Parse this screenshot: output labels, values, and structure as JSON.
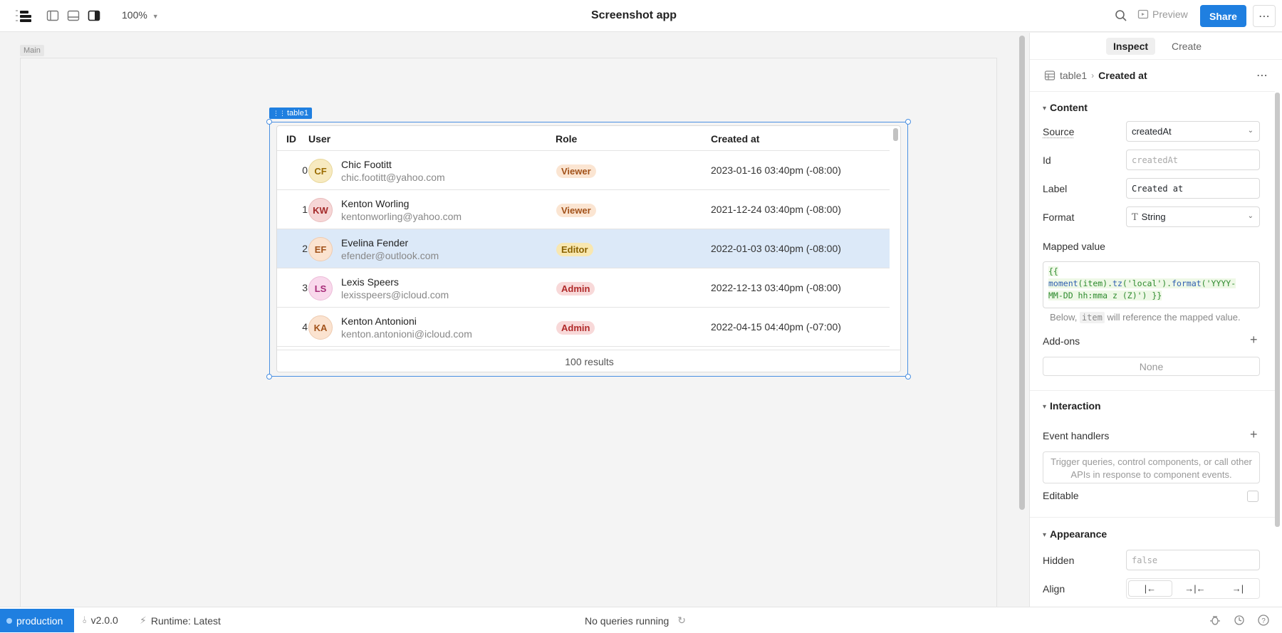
{
  "topbar": {
    "zoom": "100%",
    "title": "Screenshot app",
    "preview_label": "Preview",
    "share_label": "Share",
    "more_label": "⋯"
  },
  "canvas": {
    "frame_label": "Main",
    "component_tag": "table1"
  },
  "table": {
    "headers": {
      "id": "ID",
      "user": "User",
      "role": "Role",
      "created": "Created at"
    },
    "rows": [
      {
        "id": "0",
        "initials": "CF",
        "name": "Chic Footitt",
        "email": "chic.footitt@yahoo.com",
        "role": "Viewer",
        "created": "2023-01-16 03:40pm (-08:00)"
      },
      {
        "id": "1",
        "initials": "KW",
        "name": "Kenton Worling",
        "email": "kentonworling@yahoo.com",
        "role": "Viewer",
        "created": "2021-12-24 03:40pm (-08:00)"
      },
      {
        "id": "2",
        "initials": "EF",
        "name": "Evelina Fender",
        "email": "efender@outlook.com",
        "role": "Editor",
        "created": "2022-01-03 03:40pm (-08:00)"
      },
      {
        "id": "3",
        "initials": "LS",
        "name": "Lexis Speers",
        "email": "lexisspeers@icloud.com",
        "role": "Admin",
        "created": "2022-12-13 03:40pm (-08:00)"
      },
      {
        "id": "4",
        "initials": "KA",
        "name": "Kenton Antonioni",
        "email": "kenton.antonioni@icloud.com",
        "role": "Admin",
        "created": "2022-04-15 04:40pm (-07:00)"
      }
    ],
    "footer": "100 results"
  },
  "inspector": {
    "tabs": {
      "inspect": "Inspect",
      "create": "Create"
    },
    "breadcrumb": {
      "component": "table1",
      "column": "Created at"
    },
    "content": {
      "title": "Content",
      "source_label": "Source",
      "source_value": "createdAt",
      "id_label": "Id",
      "id_placeholder": "createdAt",
      "label_label": "Label",
      "label_value": "Created at",
      "format_label": "Format",
      "format_value": "String",
      "mapped_label": "Mapped value",
      "mapped_code": {
        "open": "{{",
        "fn1": "moment",
        "arg1": "(item).",
        "fn2": "tz",
        "arg2": "('local').",
        "fn3": "format",
        "arg3": "('YYYY-",
        "line3": "MM-DD hh:mma z (Z)') }}"
      },
      "hint_before": "Below, ",
      "hint_code": "item",
      "hint_after": " will reference the mapped value.",
      "addons_label": "Add-ons",
      "addons_value": "None"
    },
    "interaction": {
      "title": "Interaction",
      "event_label": "Event handlers",
      "event_text": "Trigger queries, control components, or call other APIs in response to component events.",
      "editable_label": "Editable"
    },
    "appearance": {
      "title": "Appearance",
      "hidden_label": "Hidden",
      "hidden_placeholder": "false",
      "align_label": "Align"
    }
  },
  "footer": {
    "env": "production",
    "version": "v2.0.0",
    "runtime": "Runtime: Latest",
    "queries": "No queries running"
  },
  "colors": {
    "accent": "#1f7fe0",
    "viewer_bg": "#fbe5d2",
    "viewer_fg": "#a2521a",
    "editor_bg": "#f8e7b0",
    "editor_fg": "#8a6200",
    "admin_bg": "#f8d9d9",
    "admin_fg": "#b02a2a",
    "selected_row": "#dce9f8"
  }
}
